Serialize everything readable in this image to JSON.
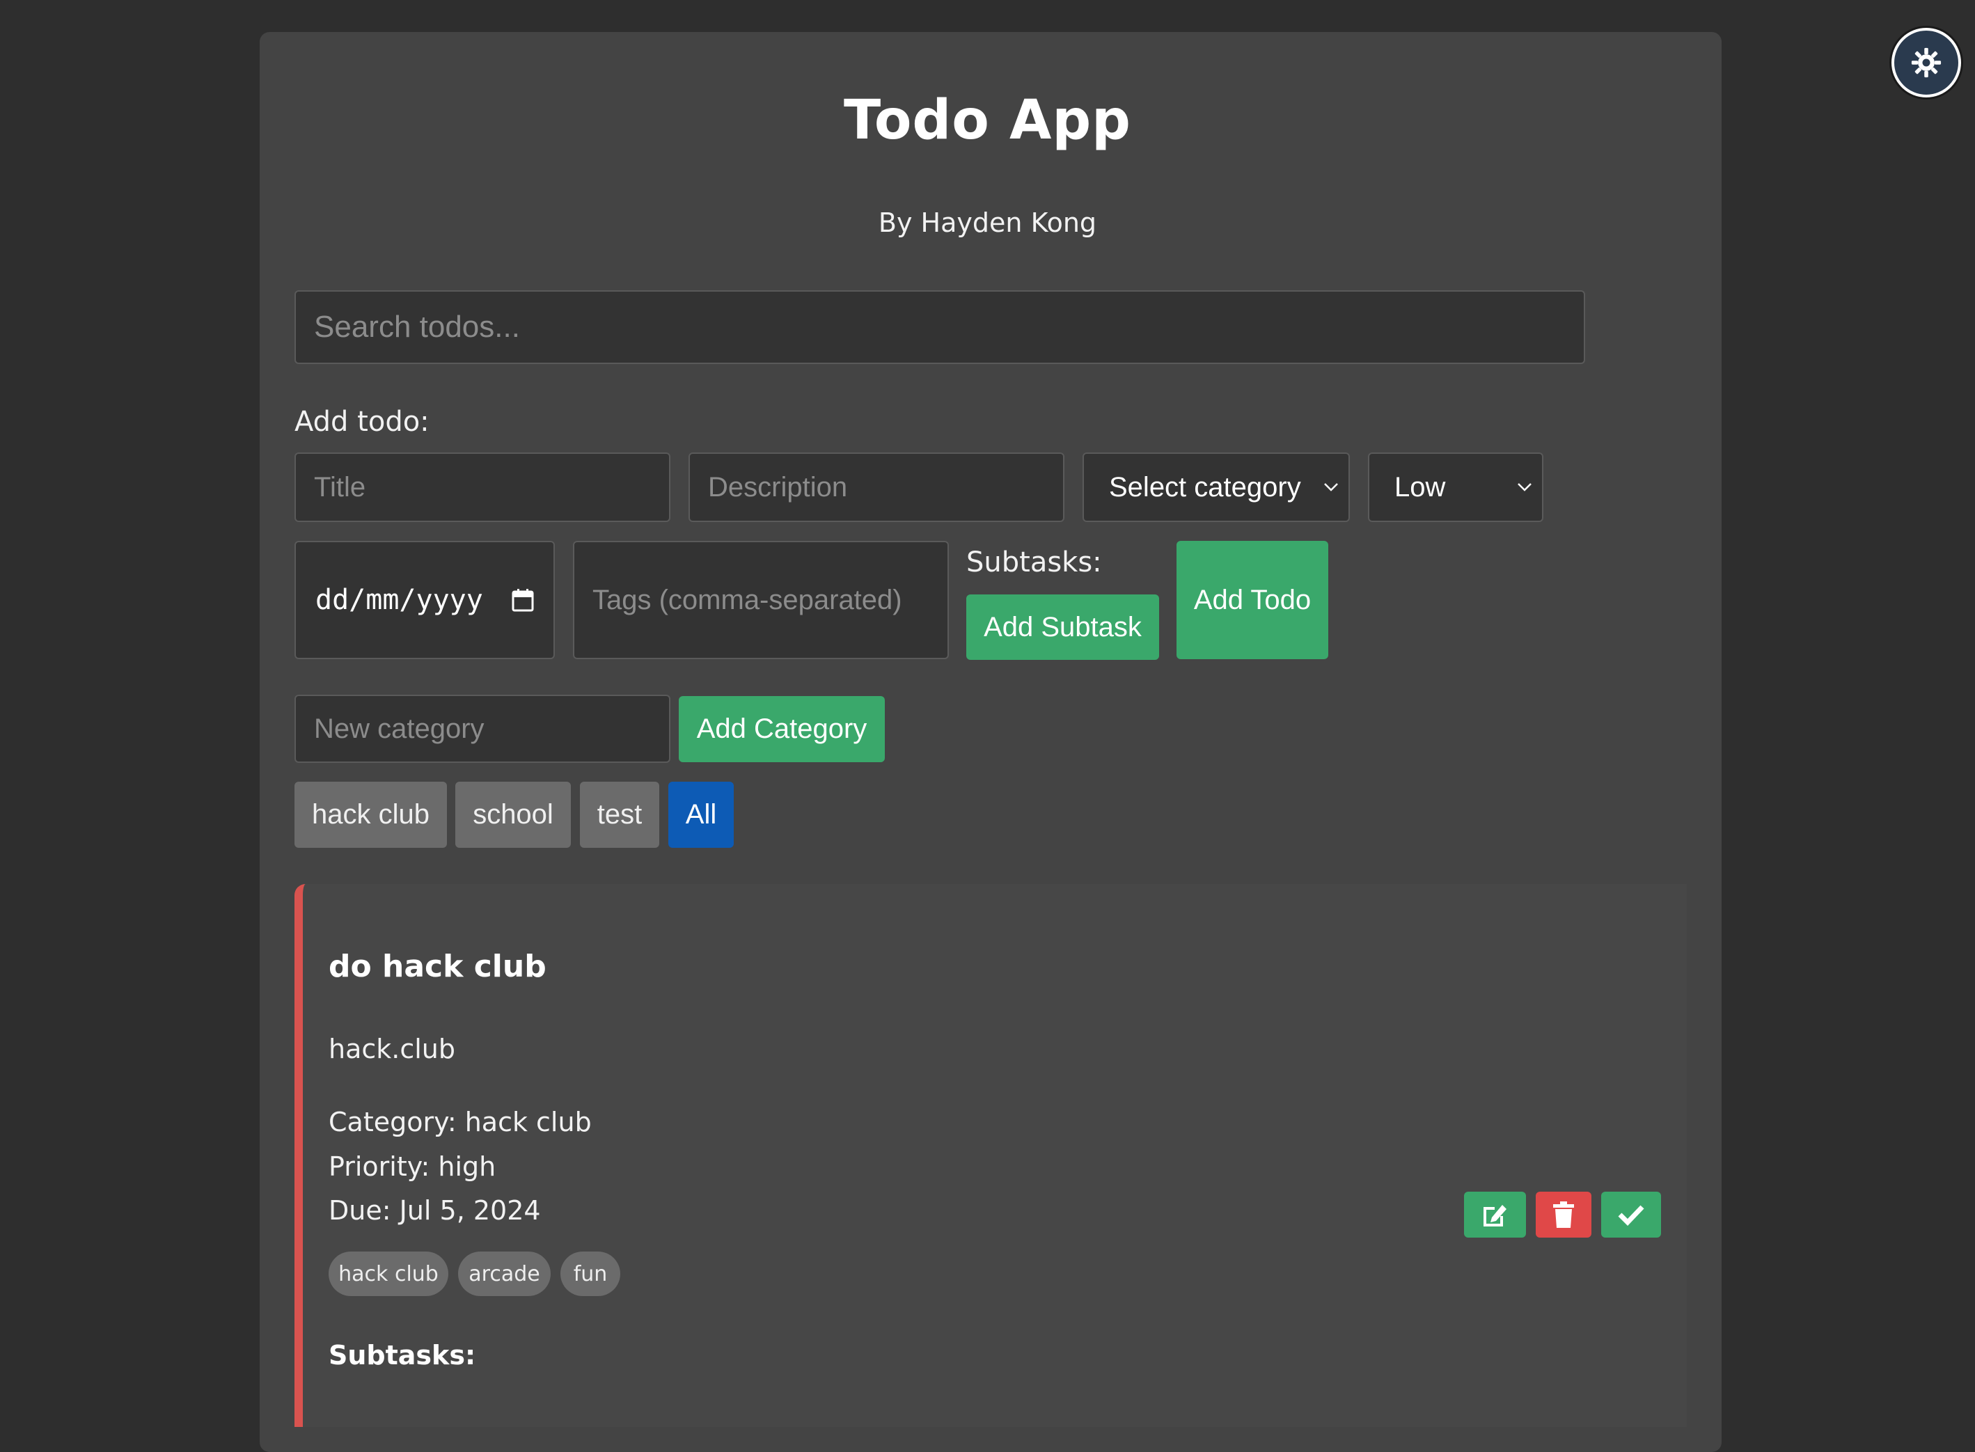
{
  "header": {
    "title": "Todo App",
    "subtitle": "By Hayden Kong"
  },
  "theme_toggle": {
    "icon": "gear-icon"
  },
  "search": {
    "placeholder": "Search todos..."
  },
  "add_todo": {
    "label": "Add todo:",
    "title_placeholder": "Title",
    "description_placeholder": "Description",
    "category_selected": "Select category",
    "priority_selected": "Low",
    "date_placeholder": "dd/mm/yyyy",
    "tags_placeholder": "Tags (comma-separated)",
    "subtasks_label": "Subtasks:",
    "add_subtask_label": "Add Subtask",
    "add_todo_label": "Add Todo"
  },
  "category_form": {
    "placeholder": "New category",
    "add_label": "Add Category"
  },
  "filters": [
    {
      "label": "hack club",
      "active": false
    },
    {
      "label": "school",
      "active": false
    },
    {
      "label": "test",
      "active": false
    },
    {
      "label": "All",
      "active": true
    }
  ],
  "todos": [
    {
      "title": "do hack club",
      "description": "hack.club",
      "category": "Category: hack club",
      "priority": "Priority: high",
      "due": "Due: Jul 5, 2024",
      "tags": [
        "hack club",
        "arcade",
        "fun"
      ],
      "subtasks_label": "Subtasks:",
      "priority_color": "#d9534f"
    }
  ],
  "colors": {
    "background": "#2e2e2e",
    "panel": "#444444",
    "accent_green": "#3aa86b",
    "danger_red": "#e04848",
    "active_blue": "#0d5bb5"
  }
}
